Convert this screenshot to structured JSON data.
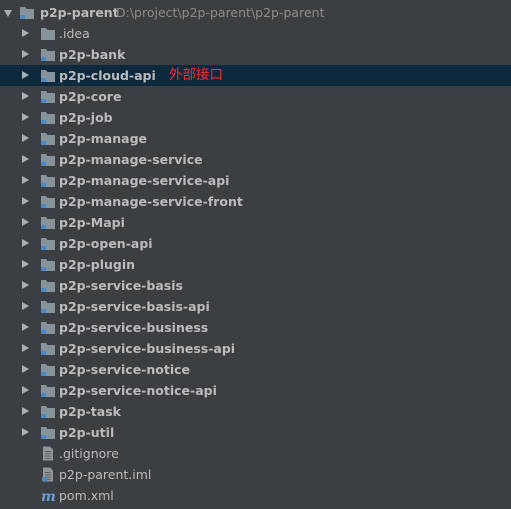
{
  "root": {
    "name": "p2p-parent",
    "path": "D:\\project\\p2p-parent\\p2p-parent",
    "icon": "module-folder-icon"
  },
  "modules": [
    {
      "name": ".idea",
      "bold": false,
      "icon": "folder-icon"
    },
    {
      "name": "p2p-bank",
      "bold": true,
      "icon": "module-folder-icon"
    },
    {
      "name": "p2p-cloud-api",
      "bold": true,
      "icon": "module-folder-icon",
      "selected": true,
      "annotation": "外部接口"
    },
    {
      "name": "p2p-core",
      "bold": true,
      "icon": "module-folder-icon"
    },
    {
      "name": "p2p-job",
      "bold": true,
      "icon": "module-folder-icon"
    },
    {
      "name": "p2p-manage",
      "bold": true,
      "icon": "module-folder-icon"
    },
    {
      "name": "p2p-manage-service",
      "bold": true,
      "icon": "module-folder-icon"
    },
    {
      "name": "p2p-manage-service-api",
      "bold": true,
      "icon": "module-folder-icon"
    },
    {
      "name": "p2p-manage-service-front",
      "bold": true,
      "icon": "module-folder-icon"
    },
    {
      "name": "p2p-Mapi",
      "bold": true,
      "icon": "module-folder-icon"
    },
    {
      "name": "p2p-open-api",
      "bold": true,
      "icon": "module-folder-icon"
    },
    {
      "name": "p2p-plugin",
      "bold": true,
      "icon": "module-folder-icon"
    },
    {
      "name": "p2p-service-basis",
      "bold": true,
      "icon": "module-folder-icon"
    },
    {
      "name": "p2p-service-basis-api",
      "bold": true,
      "icon": "module-folder-icon"
    },
    {
      "name": "p2p-service-business",
      "bold": true,
      "icon": "module-folder-icon"
    },
    {
      "name": "p2p-service-business-api",
      "bold": true,
      "icon": "module-folder-icon"
    },
    {
      "name": "p2p-service-notice",
      "bold": true,
      "icon": "module-folder-icon"
    },
    {
      "name": "p2p-service-notice-api",
      "bold": true,
      "icon": "module-folder-icon"
    },
    {
      "name": "p2p-task",
      "bold": true,
      "icon": "module-folder-icon"
    },
    {
      "name": "p2p-util",
      "bold": true,
      "icon": "module-folder-icon"
    }
  ],
  "files": [
    {
      "name": ".gitignore",
      "icon": "text-file-icon"
    },
    {
      "name": "p2p-parent.iml",
      "icon": "iml-file-icon"
    },
    {
      "name": "pom.xml",
      "icon": "maven-file-icon"
    }
  ],
  "colors": {
    "background": "#3c3f41",
    "selection": "#0d293e",
    "text": "#bbbbbb",
    "path": "#8c8c8c",
    "annotation": "#ff2b2b",
    "folder": "#87939a",
    "module_marker": "#4a88c7"
  }
}
